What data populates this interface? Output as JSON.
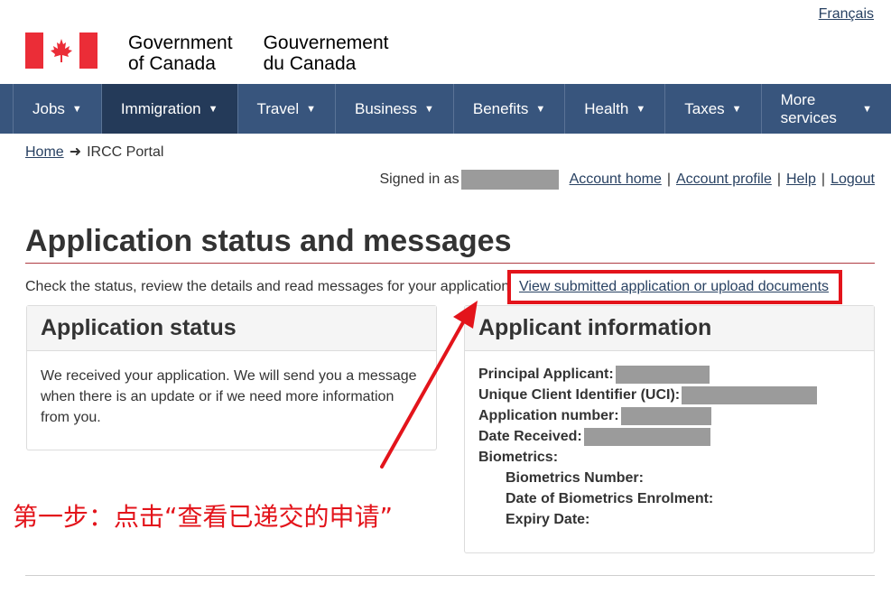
{
  "header": {
    "language_toggle": "Français",
    "wordmark_en_line1": "Government",
    "wordmark_en_line2": "of Canada",
    "wordmark_fr_line1": "Gouvernement",
    "wordmark_fr_line2": "du Canada",
    "flag_icon": "maple-leaf-flag-icon",
    "colors": {
      "flag_red": "#eb2d37"
    }
  },
  "nav": {
    "items": [
      {
        "label": "Jobs"
      },
      {
        "label": "Immigration"
      },
      {
        "label": "Travel"
      },
      {
        "label": "Business"
      },
      {
        "label": "Benefits"
      },
      {
        "label": "Health"
      },
      {
        "label": "Taxes"
      },
      {
        "label": "More services"
      }
    ],
    "chevron_icon": "chevron-down-icon",
    "colors": {
      "background": "#38557d",
      "active": "#243a59"
    }
  },
  "breadcrumb": {
    "home": "Home",
    "current": "IRCC Portal"
  },
  "account": {
    "signed_in_as": "Signed in as",
    "account_home": "Account home",
    "account_profile": "Account profile",
    "help": "Help",
    "logout": "Logout"
  },
  "main": {
    "title": "Application status and messages",
    "intro": "Check the status, review the details and read messages for your application",
    "view_link": "View submitted application or upload documents",
    "status_panel": {
      "heading": "Application status",
      "body": "We received your application. We will send you a message when there is an update or if we need more information from you."
    },
    "info_panel": {
      "heading": "Applicant information",
      "principal_applicant": "Principal Applicant:",
      "uci": "Unique Client Identifier (UCI):",
      "application_number": "Application number:",
      "date_received": "Date Received:",
      "biometrics": "Biometrics:",
      "biometrics_number": "Biometrics Number:",
      "biometrics_enrolment": "Date of Biometrics Enrolment:",
      "expiry_date": "Expiry Date:"
    }
  },
  "annotation": {
    "text": "第一步：点击“查看已递交的申请”",
    "color": "#e3141b"
  }
}
